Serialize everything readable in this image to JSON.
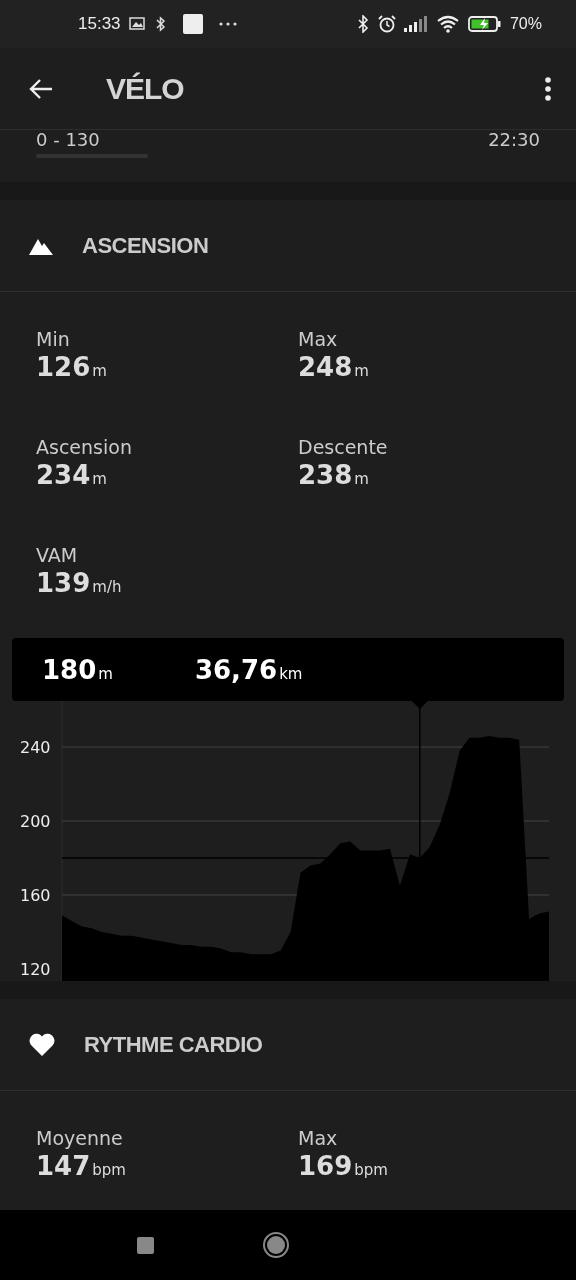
{
  "status_bar": {
    "time": "15:33",
    "battery": "70%"
  },
  "toolbar": {
    "title": "VÉLO"
  },
  "previous_row": {
    "range": "0 - 130",
    "time": "22:30"
  },
  "sections": [
    {
      "kind": "ascension",
      "title": "ASCENSION",
      "stats": [
        {
          "label": "Min",
          "value": "126",
          "unit": "m"
        },
        {
          "label": "Max",
          "value": "248",
          "unit": "m"
        },
        {
          "label": "Ascension",
          "value": "234",
          "unit": "m"
        },
        {
          "label": "Descente",
          "value": "238",
          "unit": "m"
        },
        {
          "label": "VAM",
          "value": "139",
          "unit": "m/h"
        }
      ],
      "tooltip": [
        {
          "value": "180",
          "unit": "m"
        },
        {
          "value": "36,76",
          "unit": "km"
        }
      ],
      "chart_data": {
        "type": "area",
        "ylim": [
          113.5,
          264.9
        ],
        "yticks": [
          120,
          160,
          200,
          240
        ],
        "grid": true,
        "series": [
          {
            "color": "#000000",
            "values": [
              149,
              146,
              143,
              142,
              140,
              139,
              138,
              138,
              137,
              136,
              135,
              134,
              133,
              133,
              132,
              132,
              131,
              129,
              129,
              128,
              128,
              128,
              130,
              140,
              172,
              176,
              177,
              182,
              188,
              189,
              184,
              184,
              184,
              185,
              165,
              182,
              180,
              186,
              198,
              215,
              238,
              245,
              245,
              246,
              245,
              245,
              244,
              147,
              150,
              151
            ]
          }
        ],
        "ref_lines": [
          {
            "axis": "y",
            "value": 180
          }
        ]
      }
    },
    {
      "kind": "heart",
      "title": "RYTHME CARDIO",
      "stats": [
        {
          "label": "Moyenne",
          "value": "147",
          "unit": "bpm"
        },
        {
          "label": "Max",
          "value": "169",
          "unit": "bpm"
        }
      ]
    }
  ]
}
